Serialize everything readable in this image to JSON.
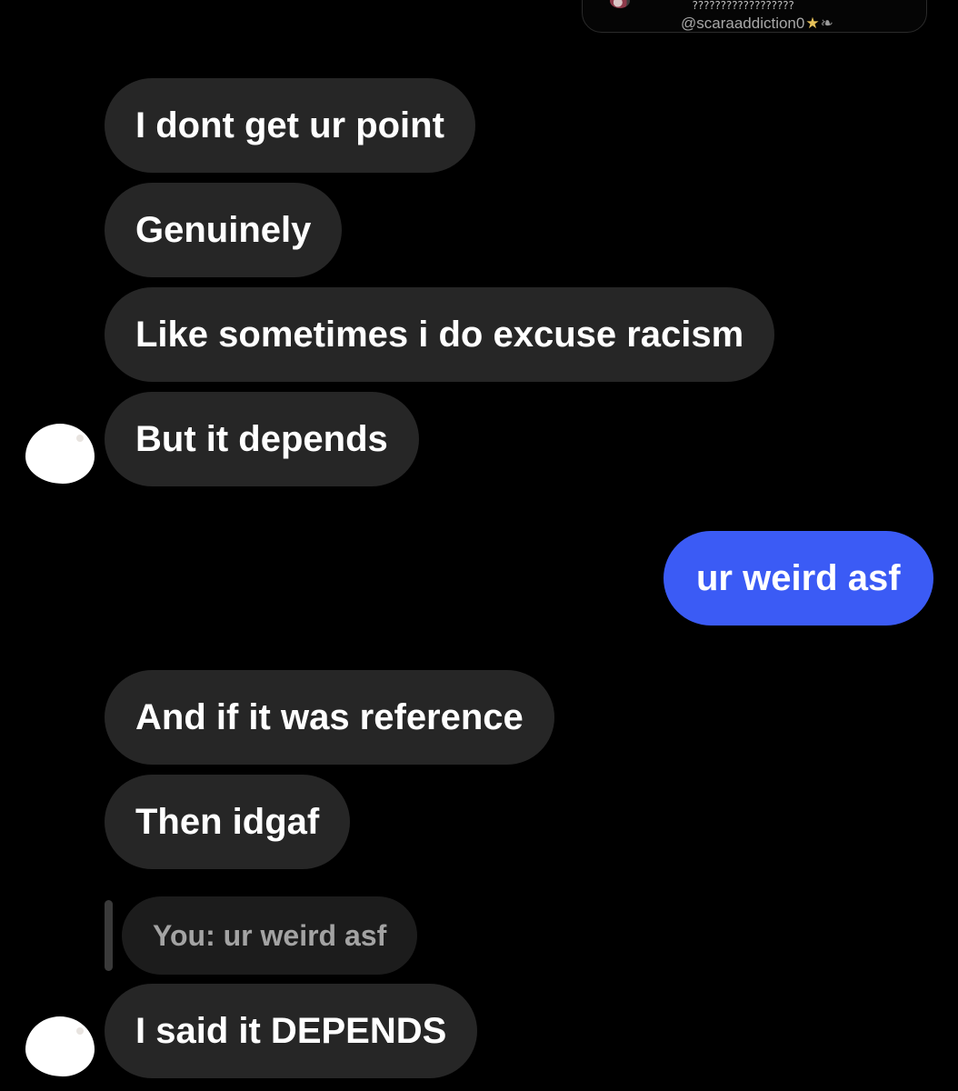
{
  "header": {
    "handle": "@scaraaddiction0",
    "title_obscured": "??????????????????",
    "star_glyph": "★",
    "leaf_glyph": "❧"
  },
  "messages": [
    {
      "from": "them",
      "text": "I dont get ur point"
    },
    {
      "from": "them",
      "text": "Genuinely"
    },
    {
      "from": "them",
      "text": "Like sometimes i do excuse racism"
    },
    {
      "from": "them",
      "text": "But it depends"
    },
    {
      "from": "me",
      "text": "ur weird asf"
    },
    {
      "from": "them",
      "text": "And if it was reference"
    },
    {
      "from": "them",
      "text": "Then idgaf"
    },
    {
      "from": "them",
      "text": "I said it DEPENDS",
      "reply_to": "You: ur weird asf"
    }
  ],
  "colors": {
    "background": "#000000",
    "received_bubble": "#262626",
    "sent_bubble": "#3b5bf5",
    "reply_bubble": "#1c1c1c"
  }
}
